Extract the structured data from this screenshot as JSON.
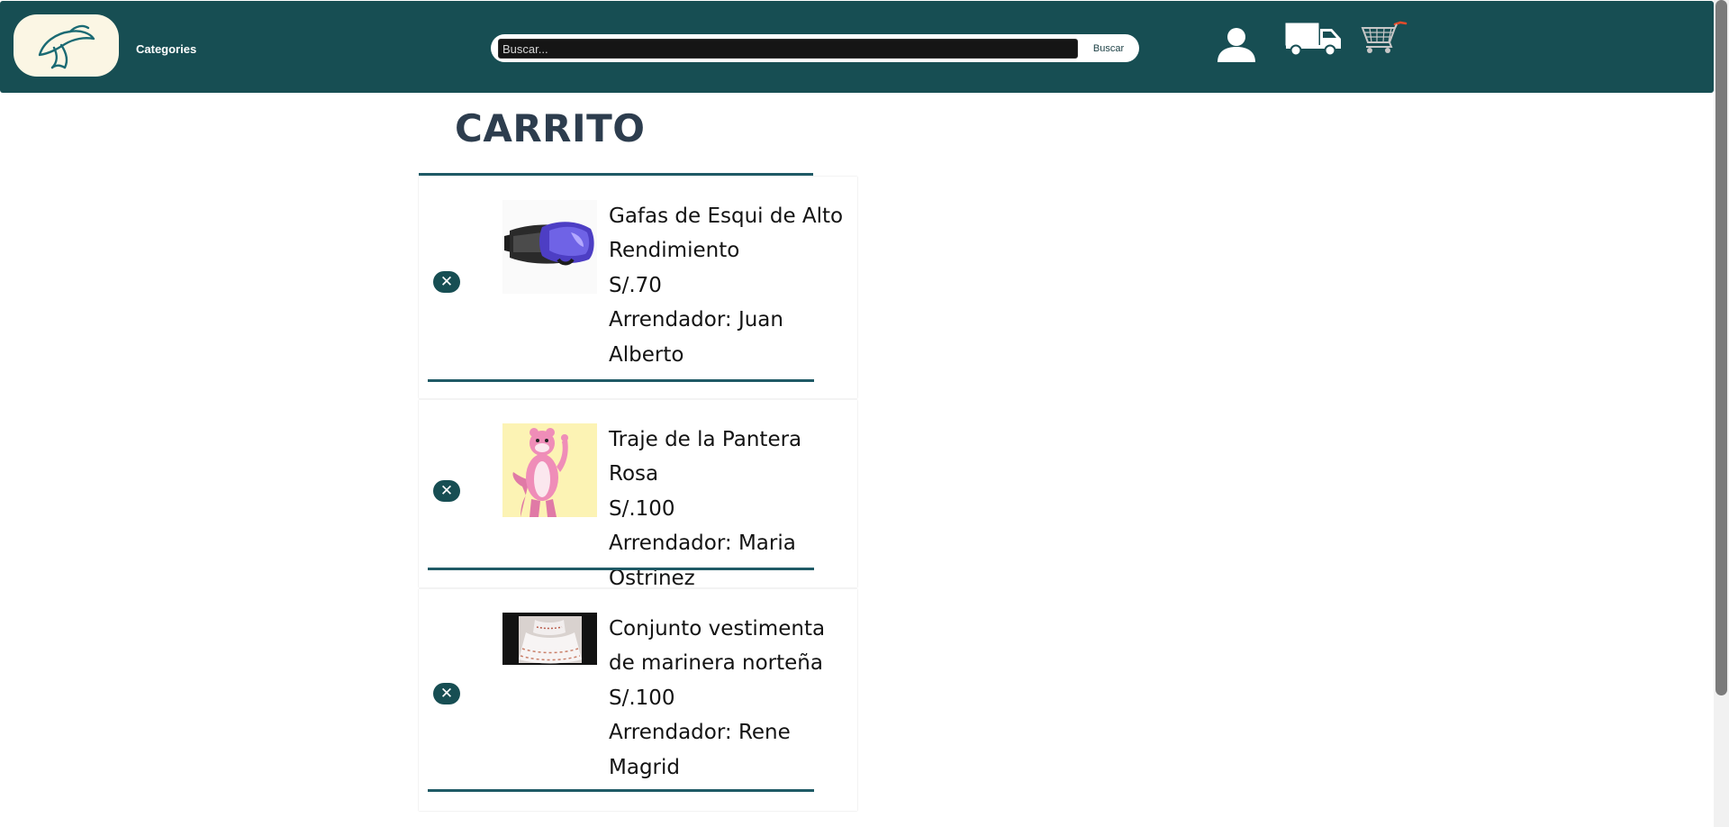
{
  "header": {
    "categories_label": "Categories",
    "search_placeholder": "Buscar...",
    "search_button": "Buscar",
    "icons": [
      "logo-icon",
      "user-icon",
      "truck-icon",
      "cart-icon"
    ],
    "bg_color": "#174e53"
  },
  "page": {
    "title": "CARRITO"
  },
  "cart": {
    "items": [
      {
        "name": "Gafas de Esqui de Alto Rendimiento",
        "price": "S/.70",
        "lessor": "Arrendador: Juan Alberto",
        "image": "ski-goggles-image"
      },
      {
        "name": "Traje de la Pantera Rosa",
        "price": "S/.100",
        "lessor": "Arrendador: Maria Ostrinez",
        "image": "pink-panther-costume-image"
      },
      {
        "name": "Conjunto vestimenta de marinera norteña",
        "price": "S/.100",
        "lessor": "Arrendador: Rene Magrid",
        "image": "marinera-dress-image"
      }
    ]
  }
}
